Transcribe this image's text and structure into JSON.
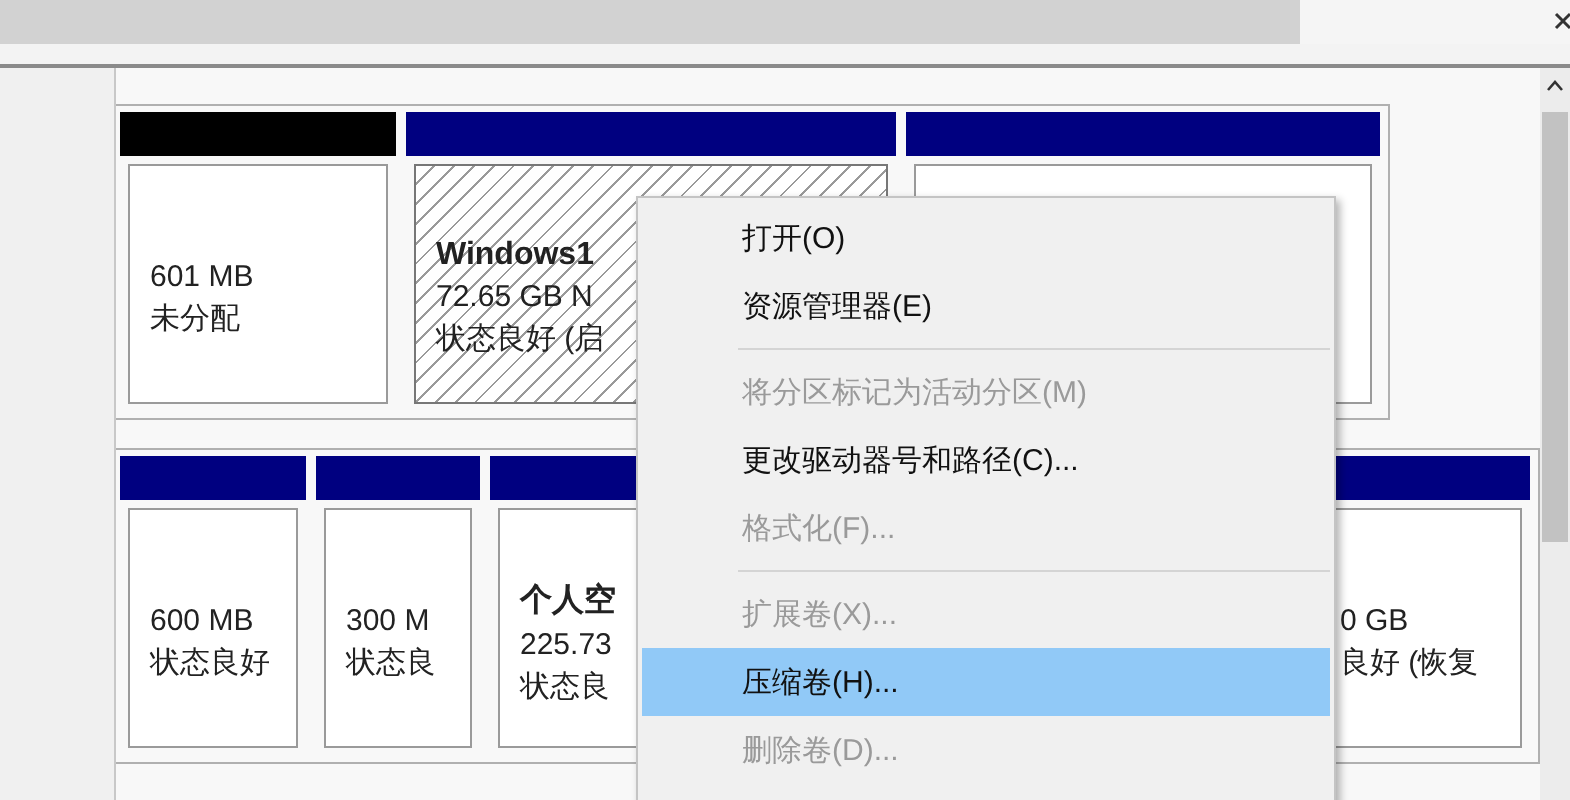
{
  "disks": [
    {
      "partitions": [
        {
          "kind": "unallocated",
          "selected": false,
          "size": "601 MB",
          "status": "未分配"
        },
        {
          "kind": "primary",
          "selected": true,
          "name": "Windows1",
          "size": "72.65 GB N",
          "status": "状态良好 (启"
        },
        {
          "kind": "primary",
          "selected": false
        }
      ]
    },
    {
      "partitions": [
        {
          "kind": "primary",
          "selected": false,
          "size": "600 MB",
          "status": "状态良好"
        },
        {
          "kind": "primary",
          "selected": false,
          "size": "300 M",
          "status": "状态良"
        },
        {
          "kind": "primary",
          "selected": false,
          "name": "个人空",
          "size": "225.73",
          "status": "状态良"
        },
        {
          "kind": "primary",
          "selected": false,
          "size": "0 GB",
          "status": "良好 (恢复"
        }
      ]
    }
  ],
  "context_menu": [
    {
      "kind": "item",
      "label": "打开(O)",
      "disabled": false,
      "selected": false
    },
    {
      "kind": "item",
      "label": "资源管理器(E)",
      "disabled": false,
      "selected": false
    },
    {
      "kind": "separator"
    },
    {
      "kind": "item",
      "label": "将分区标记为活动分区(M)",
      "disabled": true,
      "selected": false
    },
    {
      "kind": "item",
      "label": "更改驱动器号和路径(C)...",
      "disabled": false,
      "selected": false
    },
    {
      "kind": "item",
      "label": "格式化(F)...",
      "disabled": true,
      "selected": false
    },
    {
      "kind": "separator"
    },
    {
      "kind": "item",
      "label": "扩展卷(X)...",
      "disabled": true,
      "selected": false
    },
    {
      "kind": "item",
      "label": "压缩卷(H)...",
      "disabled": false,
      "selected": true
    },
    {
      "kind": "item",
      "label": "删除卷(D)...",
      "disabled": true,
      "selected": false
    }
  ]
}
